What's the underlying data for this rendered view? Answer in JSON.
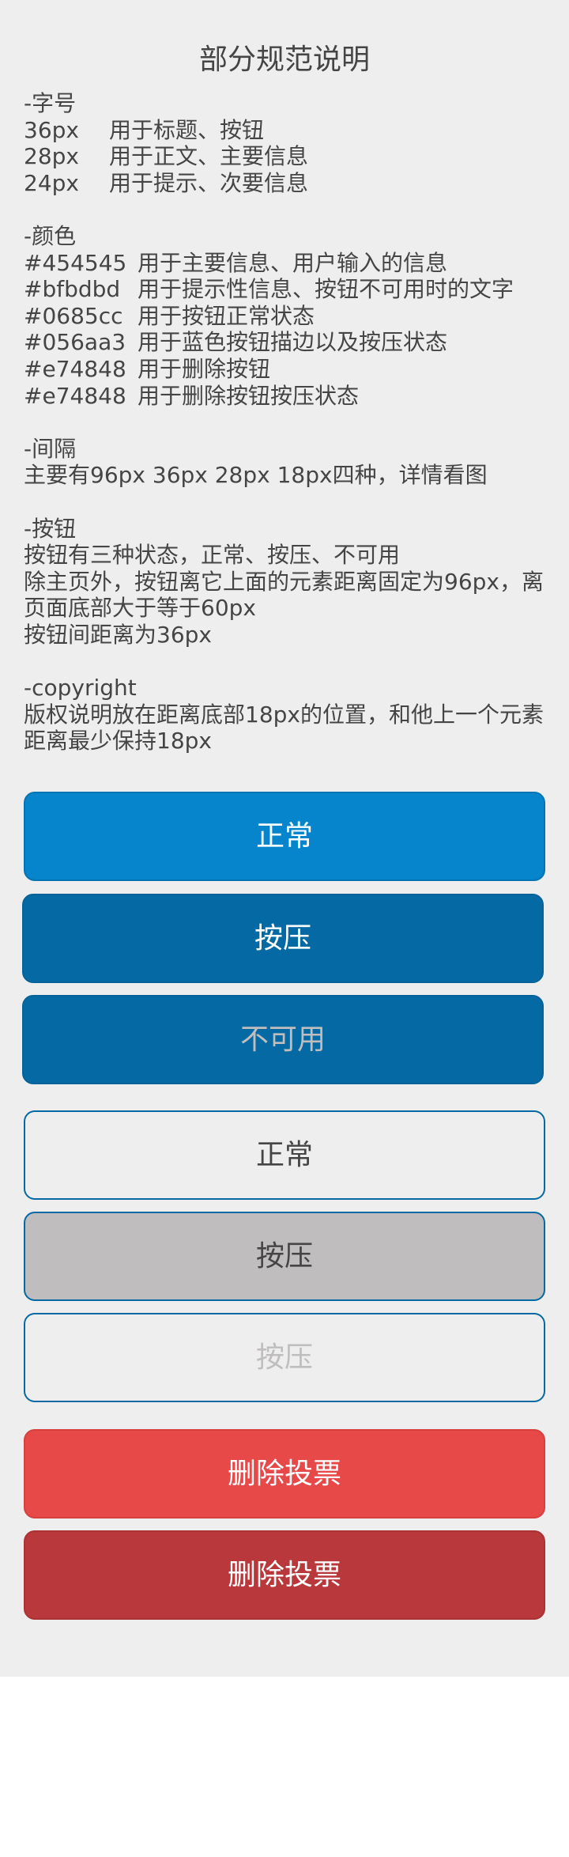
{
  "title": "部分规范说明",
  "font_section": {
    "heading": "-字号",
    "rows": [
      {
        "size": "36px",
        "desc": "用于标题、按钮"
      },
      {
        "size": "28px",
        "desc": "用于正文、主要信息"
      },
      {
        "size": "24px",
        "desc": "用于提示、次要信息"
      }
    ]
  },
  "color_section": {
    "heading": "-颜色",
    "rows": [
      {
        "code": "#454545",
        "desc": "用于主要信息、用户输入的信息"
      },
      {
        "code": "#bfbdbd",
        "desc": "用于提示性信息、按钮不可用时的文字"
      },
      {
        "code": "#0685cc",
        "desc": "用于按钮正常状态"
      },
      {
        "code": "#056aa3",
        "desc": "用于蓝色按钮描边以及按压状态"
      },
      {
        "code": "#e74848",
        "desc": "用于删除按钮"
      },
      {
        "code": "#e74848",
        "desc": "用于删除按钮按压状态"
      }
    ]
  },
  "spacing_section": {
    "heading": "-间隔",
    "text": "主要有96px 36px 28px 18px四种，详情看图"
  },
  "button_section": {
    "heading": "-按钮",
    "lines": [
      "按钮有三种状态，正常、按压、不可用",
      "除主页外，按钮离它上面的元素距离固定为96px，离页面底部大于等于60px",
      "按钮间距离为36px"
    ]
  },
  "copyright_section": {
    "heading": "-copyright",
    "text": "版权说明放在距离底部18px的位置，和他上一个元素距离最少保持18px"
  },
  "buttons": {
    "blue_normal": "正常",
    "blue_pressed": "按压",
    "blue_disabled": "不可用",
    "white_normal": "正常",
    "white_pressed": "按压",
    "white_disabled": "按压",
    "red_normal": "删除投票",
    "red_pressed": "删除投票"
  },
  "colors": {
    "text_primary": "#454545",
    "text_hint": "#bfbdbd",
    "blue": "#0685cc",
    "blue_pressed": "#056aa3",
    "red": "#e74848",
    "red_pressed": "#b9383b",
    "page_background": "#eeeeee"
  }
}
